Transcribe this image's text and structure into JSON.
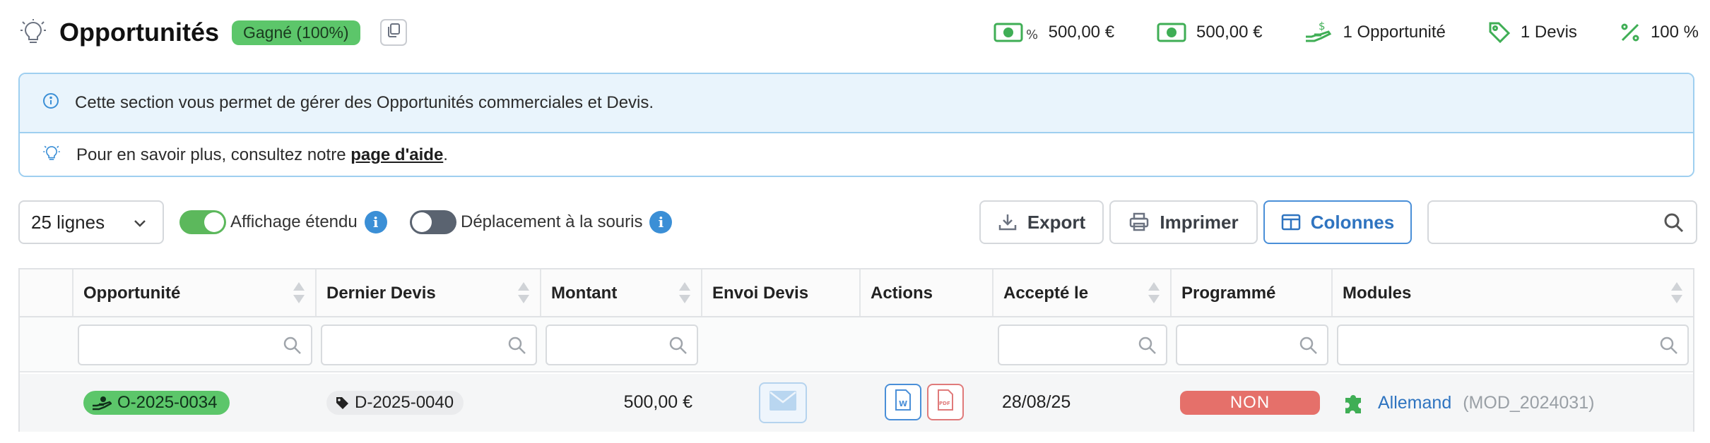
{
  "header": {
    "title": "Opportunités",
    "status": "Gagné (100%)",
    "stats": [
      {
        "icon": "money-percent-icon",
        "value": "500,00 €"
      },
      {
        "icon": "money-icon",
        "value": "500,00 €"
      },
      {
        "icon": "hand-money-icon",
        "value": "1 Opportunité"
      },
      {
        "icon": "tag-icon",
        "value": "1 Devis"
      },
      {
        "icon": "percent-icon",
        "value": "100 %"
      }
    ]
  },
  "info": {
    "line1": "Cette section vous permet de gérer des Opportunités commerciales et Devis.",
    "line2_prefix": "Pour en savoir plus, consultez notre ",
    "line2_link": "page d'aide",
    "line2_suffix": "."
  },
  "toolbar": {
    "rows_select": "25 lignes",
    "toggle_extended": {
      "label": "Affichage étendu",
      "on": true
    },
    "toggle_mouse": {
      "label": "Déplacement à la souris",
      "on": false
    },
    "export_label": "Export",
    "print_label": "Imprimer",
    "columns_label": "Colonnes",
    "search_value": ""
  },
  "table": {
    "columns": [
      "",
      "Opportunité",
      "Dernier Devis",
      "Montant",
      "Envoi Devis",
      "Actions",
      "Accepté le",
      "Programmé",
      "Modules"
    ],
    "rows": [
      {
        "opportunite": "O-2025-0034",
        "dernier_devis": "D-2025-0040",
        "montant": "500,00 €",
        "accepte_le": "28/08/25",
        "programme": "NON",
        "module_name": "Allemand",
        "module_code": "(MOD_2024031)"
      }
    ]
  },
  "colors": {
    "accent_green": "#5cc66a",
    "accent_blue": "#2f74c0",
    "danger_red": "#e5706a",
    "info_bg": "#e9f4fc"
  }
}
